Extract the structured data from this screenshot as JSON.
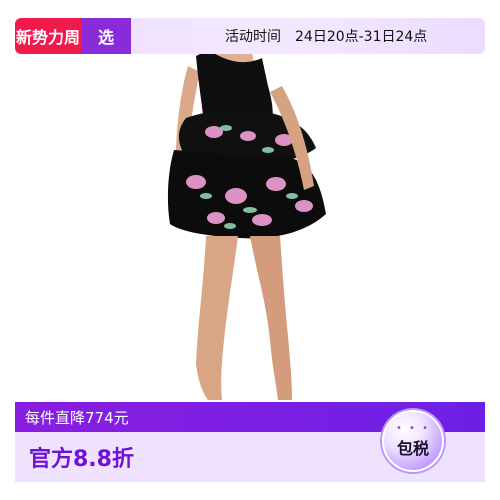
{
  "top_banner": {
    "badge_new": "新势力周",
    "badge_pick": "选",
    "event_label": "活动时间",
    "event_range": "24日20点-31日24点"
  },
  "product_image": {
    "alt": "black one-shoulder ruffle mini dress with pink floral print"
  },
  "promo": {
    "unit_price": "每件直降774元",
    "discount": "官方8.8折",
    "tax_dots": "• • •",
    "tax_label": "包税"
  },
  "colors": {
    "badge_red": "#f01a4c",
    "badge_purple": "#8a2bd9",
    "promo_purple": "#7a1ee3",
    "promo_light": "#efe2ff"
  }
}
